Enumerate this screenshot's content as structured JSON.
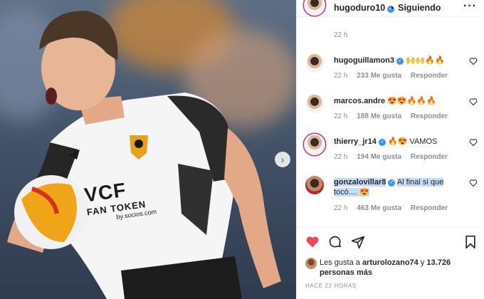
{
  "post": {
    "author": "hugoduro10",
    "follow_state": "Siguiendo",
    "dot": "•",
    "caption_time": "22 h",
    "icons": {
      "verified": "verified-badge-icon",
      "more": "more-options-icon",
      "next": "carousel-next-icon"
    },
    "next_glyph": "›",
    "more_glyph": "···"
  },
  "photo": {
    "shirt_sponsor": "VCF",
    "shirt_sponsor_line2": "FAN TOKEN",
    "shirt_sponsor_line3": "by socios.com"
  },
  "comments": [
    {
      "user": "hugoguillamon3",
      "text": "🙌🙌🔥🔥",
      "time": "22 h",
      "likes": "233 Me gusta",
      "reply": "Responder"
    },
    {
      "user": "marcos.andre",
      "text": "😍😍🔥🔥🔥",
      "time": "22 h",
      "likes": "188 Me gusta",
      "reply": "Responder"
    },
    {
      "user": "thierry_jr14",
      "text": "🔥😍 VAMOS",
      "time": "22 h",
      "likes": "194 Me gusta",
      "reply": "Responder"
    },
    {
      "user": "gonzalovillar8",
      "text": "Al final si que tocó.... 😍",
      "time": "22 h",
      "likes": "463 Me gusta",
      "reply": "Responder"
    }
  ],
  "likes": {
    "prefix": "Les gusta a",
    "user": "arturolozano74",
    "conj": "y",
    "count": "13.726 personas más"
  },
  "posted_ago": "HACE 22 HORAS",
  "colors": {
    "like_red": "#ed4956",
    "verified_blue": "#3897f0",
    "highlight": "#c7dcf7",
    "muted": "#8e8e8e"
  }
}
